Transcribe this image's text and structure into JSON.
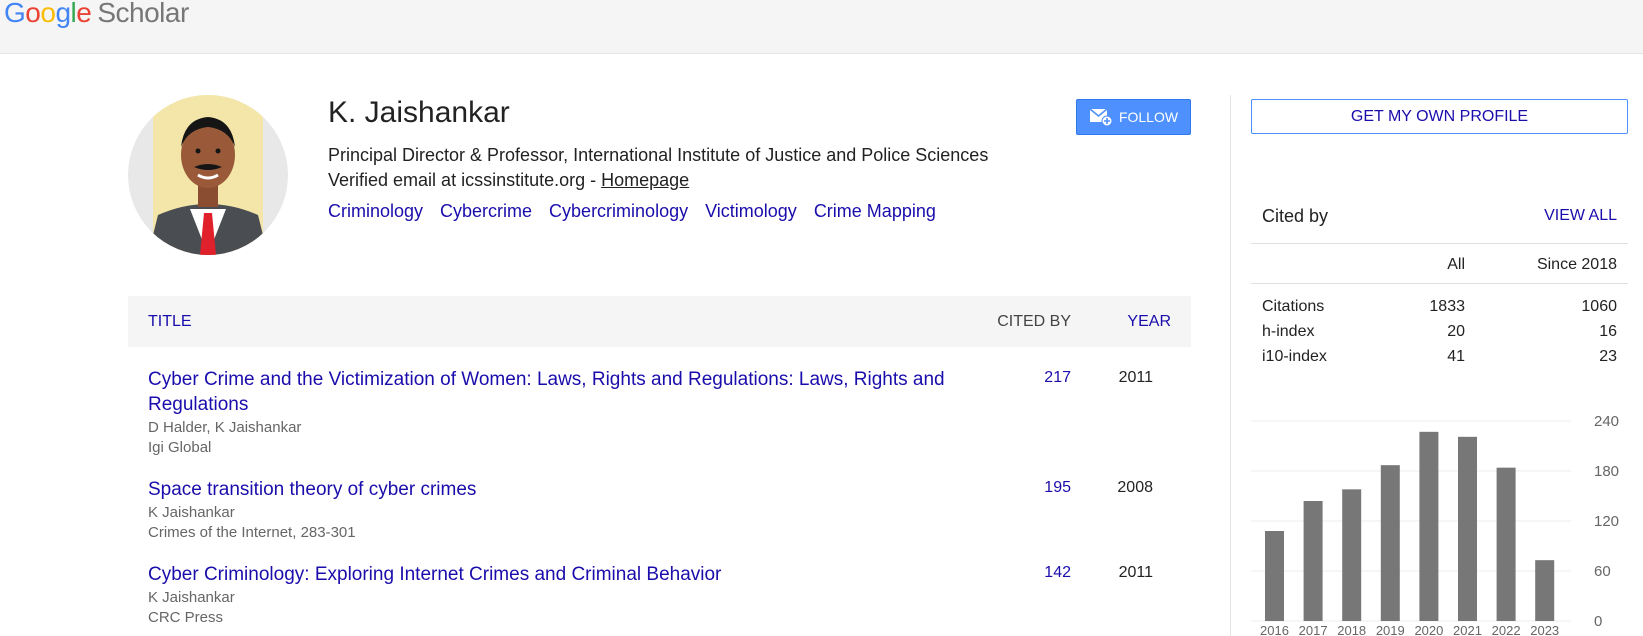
{
  "header": {
    "logo_letters": [
      "G",
      "o",
      "o",
      "g",
      "l",
      "e"
    ],
    "logo_suffix": "Scholar"
  },
  "profile": {
    "name": "K. Jaishankar",
    "affiliation": "Principal Director & Professor, International Institute of Justice and Police Sciences",
    "email_text": "Verified email at icssinstitute.org - ",
    "homepage_label": "Homepage",
    "interests": [
      "Criminology",
      "Cybercrime",
      "Cybercriminology",
      "Victimology",
      "Crime Mapping"
    ],
    "follow_label": "FOLLOW"
  },
  "table": {
    "col_title": "TITLE",
    "col_cited": "CITED BY",
    "col_year": "YEAR",
    "rows": [
      {
        "title": "Cyber Crime and the Victimization of Women: Laws, Rights and Regulations: Laws, Rights and Regulations",
        "authors": "D Halder, K Jaishankar",
        "venue": "Igi Global",
        "cited": "217",
        "year": "2011"
      },
      {
        "title": "Space transition theory of cyber crimes",
        "authors": "K Jaishankar",
        "venue": "Crimes of the Internet, 283-301",
        "cited": "195",
        "year": "2008"
      },
      {
        "title": "Cyber Criminology: Exploring Internet Crimes and Criminal Behavior",
        "authors": "K Jaishankar",
        "venue": "CRC Press",
        "cited": "142",
        "year": "2011"
      }
    ]
  },
  "sidebar": {
    "get_profile_label": "GET MY OWN PROFILE",
    "cited_by_label": "Cited by",
    "view_all_label": "VIEW ALL",
    "col_all": "All",
    "col_since": "Since 2018",
    "stats": [
      {
        "label": "Citations",
        "all": "1833",
        "since": "1060"
      },
      {
        "label": "h-index",
        "all": "20",
        "since": "16"
      },
      {
        "label": "i10-index",
        "all": "41",
        "since": "23"
      }
    ]
  },
  "chart_data": {
    "type": "bar",
    "categories": [
      "2016",
      "2017",
      "2018",
      "2019",
      "2020",
      "2021",
      "2022",
      "2023"
    ],
    "values": [
      108,
      144,
      158,
      187,
      227,
      221,
      184,
      73
    ],
    "ylim": [
      0,
      240
    ],
    "yticks": [
      0,
      60,
      120,
      180,
      240
    ],
    "grid": true,
    "bar_color": "#777777"
  }
}
